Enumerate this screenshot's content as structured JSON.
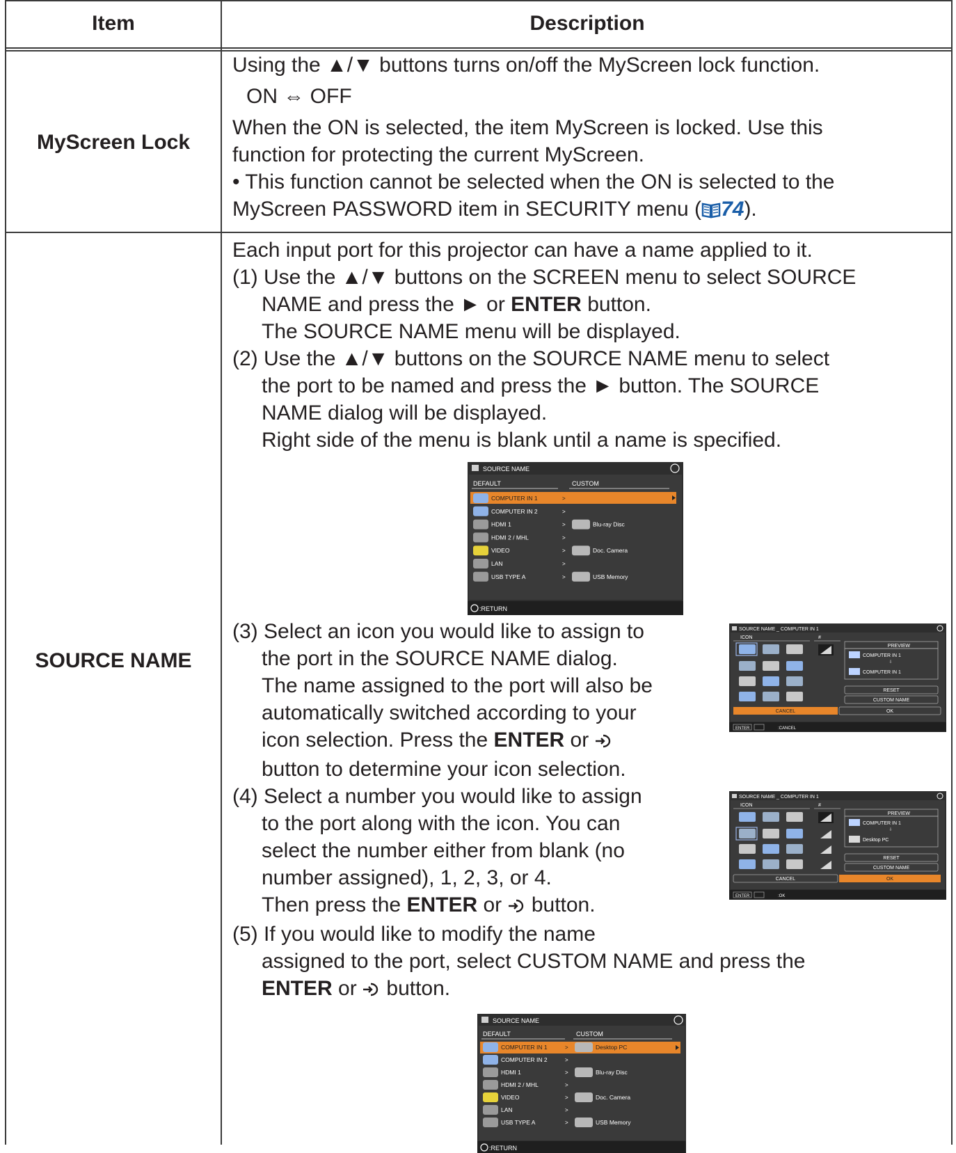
{
  "header": {
    "item": "Item",
    "description": "Description"
  },
  "rows": [
    {
      "item": "MyScreen Lock",
      "lines": [
        "Using the ▲/▼ buttons turns on/off the MyScreen lock function.",
        "ON ⇔ OFF",
        "When the ON is selected, the item MyScreen is locked. Use this",
        "function for protecting the current MyScreen.",
        "• This function cannot be selected when the ON is selected to the",
        "MyScreen PASSWORD item in SECURITY menu ("
      ],
      "ref_page": "74",
      "ref_close": ")."
    },
    {
      "item": "SOURCE NAME",
      "intro": "Each input port for this projector can have a name applied to it.",
      "step1": [
        "(1) Use the ▲/▼ buttons on the SCREEN menu to select SOURCE",
        "NAME and press the ► or ",
        "ENTER",
        " button.",
        "The SOURCE NAME menu will be displayed."
      ],
      "step2": [
        "(2) Use the ▲/▼ buttons on the SOURCE NAME menu to select",
        "the port to be named and press the ► button. The SOURCE",
        "NAME dialog will be displayed.",
        "Right side of the menu is blank until a name is specified."
      ],
      "step3": [
        "(3) Select an icon you would like to assign to",
        "the port in the SOURCE NAME dialog.",
        "The name assigned to the port will also be",
        "automatically switched according to your",
        "icon selection. Press the ",
        "ENTER",
        " or ",
        "button to determine your icon selection."
      ],
      "step4": [
        "(4) Select a number you would like to assign",
        "to the port along with the icon. You can",
        "select the number either from blank (no",
        "number assigned), 1, 2, 3, or 4.",
        "Then press the ",
        "ENTER",
        " or ",
        " button."
      ],
      "step5": [
        "(5) If you would like to modify the name",
        "assigned to the port, select CUSTOM NAME and press the",
        "ENTER",
        " or ",
        " button."
      ]
    }
  ],
  "menu1": {
    "title": "SOURCE NAME",
    "col_default": "DEFAULT",
    "col_custom": "CUSTOM",
    "items": [
      "COMPUTER IN 1",
      "COMPUTER IN 2",
      "HDMI 1",
      "HDMI 2 / MHL",
      "VIDEO",
      "LAN",
      "USB TYPE A"
    ],
    "customs": [
      "",
      "",
      "Blu-ray Disc",
      "",
      "Doc. Camera",
      "",
      "USB Memory"
    ],
    "footer": ":RETURN"
  },
  "menu2": {
    "title": "SOURCE NAME",
    "col_default": "DEFAULT",
    "col_custom": "CUSTOM",
    "items": [
      "COMPUTER IN 1",
      "COMPUTER IN 2",
      "HDMI 1",
      "HDMI 2 / MHL",
      "VIDEO",
      "LAN",
      "USB TYPE A"
    ],
    "customs": [
      "Desktop PC",
      "",
      "Blu-ray Disc",
      "",
      "Doc. Camera",
      "",
      "USB Memory"
    ],
    "footer": ":RETURN"
  },
  "dialog1": {
    "title": "SOURCE NAME _ COMPUTER IN 1",
    "icon_label": "ICON",
    "num_label": "#",
    "preview": "PREVIEW",
    "preview_top": "COMPUTER IN 1",
    "preview_bottom": "COMPUTER IN 1",
    "reset": "RESET",
    "custom_name": "CUSTOM NAME",
    "cancel": "CANCEL",
    "ok": "OK",
    "footer_enter": "ENTER",
    "footer_action": ":CANCEL"
  },
  "dialog2": {
    "title": "SOURCE NAME _ COMPUTER IN 1",
    "icon_label": "ICON",
    "num_label": "#",
    "preview": "PREVIEW",
    "preview_top": "COMPUTER IN 1",
    "preview_bottom": "Desktop PC",
    "reset": "RESET",
    "custom_name": "CUSTOM NAME",
    "cancel": "CANCEL",
    "ok": "OK",
    "footer_enter": "ENTER",
    "footer_action": ":OK"
  },
  "colors": {
    "accent": "#e8862a",
    "panel": "#2e2e2e",
    "border": "#3a3a3a",
    "ref": "#1a5ea8"
  }
}
